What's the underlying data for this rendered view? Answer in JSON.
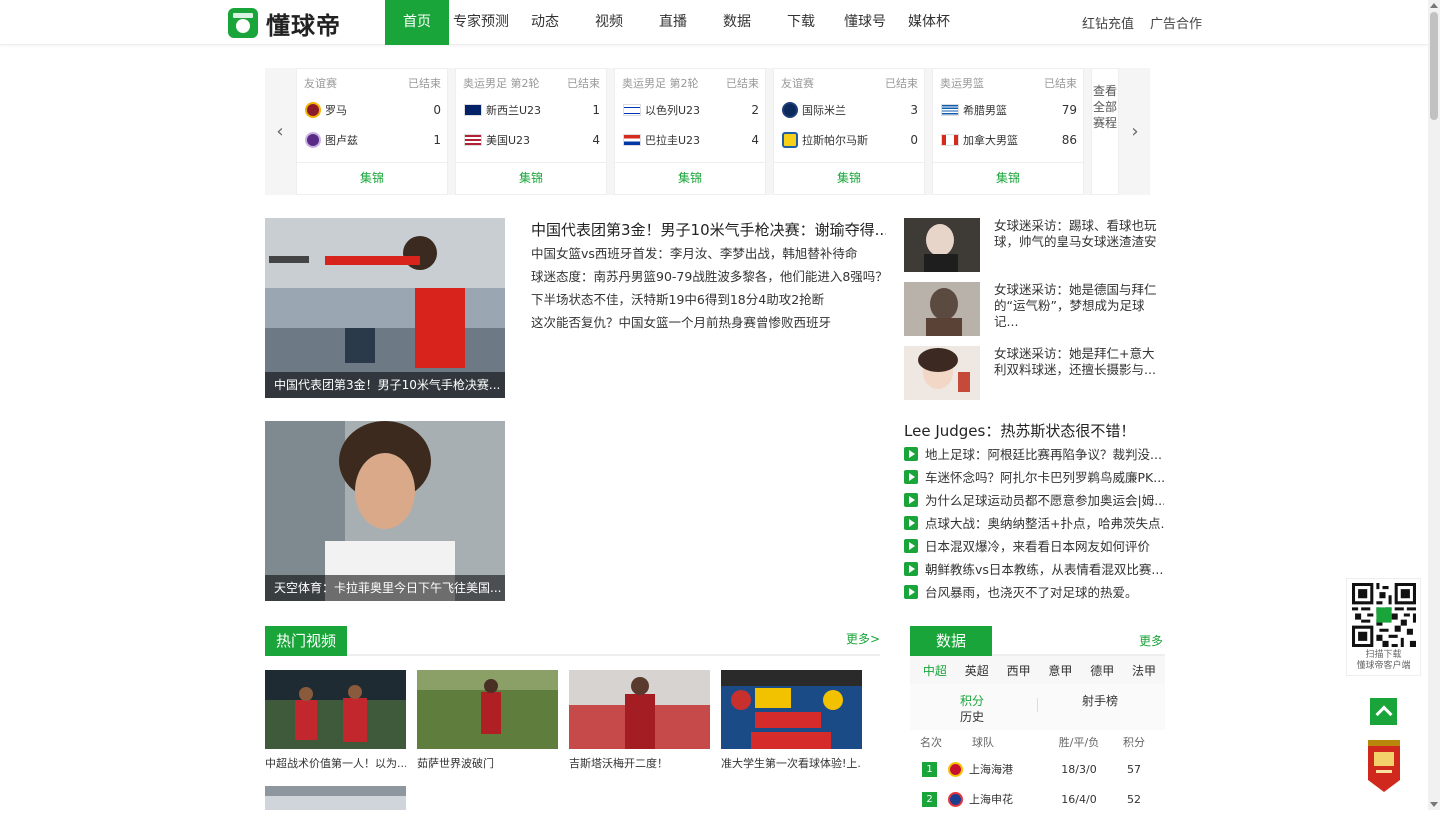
{
  "header": {
    "logo_text": "懂球帝",
    "nav": [
      "首页",
      "专家预测",
      "动态",
      "视频",
      "直播",
      "数据",
      "下载",
      "懂球号",
      "媒体杯"
    ],
    "active_nav": "首页",
    "right_links": [
      "红钻充值",
      "广告合作"
    ]
  },
  "scores": {
    "matches": [
      {
        "competition": "友谊赛",
        "status": "已结束",
        "home": "罗马",
        "home_score": "0",
        "away": "图卢兹",
        "away_score": "1",
        "footer": "集锦"
      },
      {
        "competition": "奥运男足 第2轮",
        "status": "已结束",
        "home": "新西兰U23",
        "home_score": "1",
        "away": "美国U23",
        "away_score": "4",
        "footer": "集锦"
      },
      {
        "competition": "奥运男足 第2轮",
        "status": "已结束",
        "home": "以色列U23",
        "home_score": "2",
        "away": "巴拉圭U23",
        "away_score": "4",
        "footer": "集锦"
      },
      {
        "competition": "友谊赛",
        "status": "已结束",
        "home": "国际米兰",
        "home_score": "3",
        "away": "拉斯帕尔马斯",
        "away_score": "0",
        "footer": "集锦"
      },
      {
        "competition": "奥运男篮",
        "status": "已结束",
        "home": "希腊男篮",
        "home_score": "79",
        "away": "加拿大男篮",
        "away_score": "86",
        "footer": "集锦"
      }
    ],
    "all_schedule": "查看全部赛程"
  },
  "feature": {
    "hero1_caption": "中国代表团第3金！男子10米气手枪决赛...",
    "hero2_caption": "天空体育：卡拉菲奥里今日下午飞往美国...",
    "headline": "中国代表团第3金！男子10米气手枪决赛：谢瑜夺得...",
    "links": [
      "中国女篮vs西班牙首发：李月汝、李梦出战，韩旭替补待命",
      "球迷态度：南苏丹男篮90-79战胜波多黎各，他们能进入8强吗？",
      "下半场状态不佳，沃特斯19中6得到18分4助攻2抢断",
      "这次能否复仇？中国女篮一个月前热身赛曾惨败西班牙"
    ]
  },
  "interviews": [
    "女球迷采访：踢球、看球也玩球，帅气的皇马女球迷渣渣安",
    "女球迷采访：她是德国与拜仁的“运气粉”，梦想成为足球记...",
    "女球迷采访：她是拜仁+意大利双料球迷，还擅长摄影与..."
  ],
  "video_list": {
    "title": "Lee Judges：热苏斯状态很不错！",
    "items": [
      "地上足球：阿根廷比赛再陷争议？裁判没...",
      "车迷怀念吗？阿扎尔卡巴列罗鹈鸟威廉PK...",
      "为什么足球运动员都不愿意参加奥运会|姆...",
      "点球大战：奥纳纳整活+扑点，哈弗茨失点...",
      "日本混双爆冷，来看看日本网友如何评价",
      "朝鲜教练vs日本教练，从表情看混双比赛...",
      "台风暴雨，也浇灭不了对足球的热爱。"
    ]
  },
  "hot_videos": {
    "title": "热门视频",
    "more": "更多>",
    "items": [
      "中超战术价值第一人！以为...",
      "茹萨世界波破门",
      "吉斯塔沃梅开二度！",
      "准大学生第一次看球体验!上..."
    ]
  },
  "data_panel": {
    "title": "数据",
    "more": "更多",
    "leagues": [
      "中超",
      "英超",
      "西甲",
      "意甲",
      "德甲",
      "法甲"
    ],
    "active_league": "中超",
    "tabs": [
      "积分",
      "历史",
      "射手榜"
    ],
    "headers": [
      "名次",
      "球队",
      "胜/平/负",
      "积分"
    ],
    "rows": [
      {
        "rank": "1",
        "team": "上海海港",
        "record": "18/3/0",
        "points": "57"
      },
      {
        "rank": "2",
        "team": "上海申花",
        "record": "16/4/0",
        "points": "52"
      }
    ]
  },
  "widgets": {
    "qr_text_1": "扫描下载",
    "qr_text_2": "懂球帝客户端"
  },
  "colors": {
    "brand_green": "#1aa53a"
  }
}
